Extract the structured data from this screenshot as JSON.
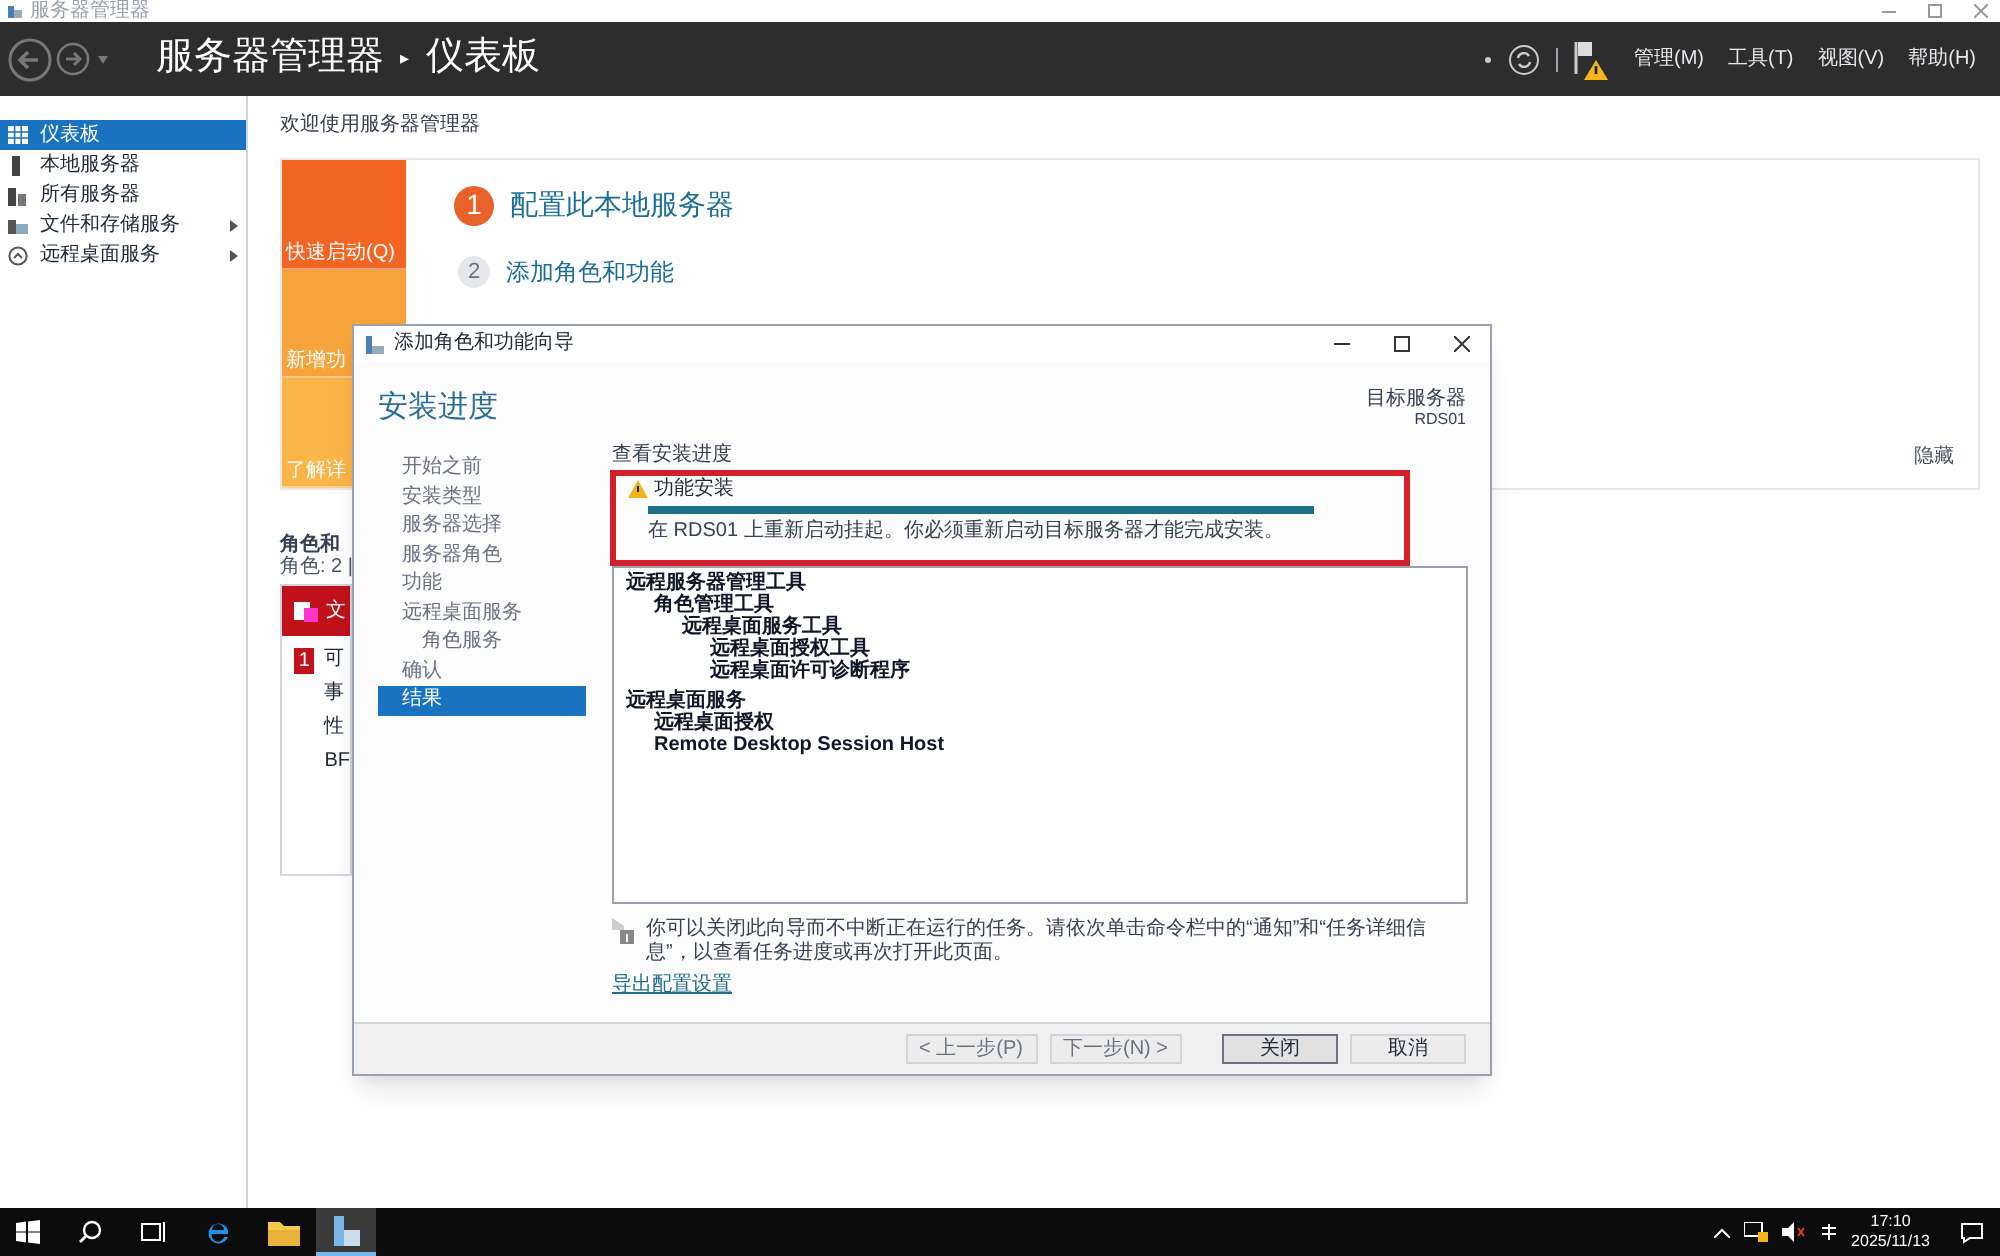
{
  "window": {
    "title": "服务器管理器"
  },
  "header": {
    "app": "服务器管理器",
    "separator": "▸",
    "page": "仪表板",
    "menus": [
      "管理(M)",
      "工具(T)",
      "视图(V)",
      "帮助(H)"
    ]
  },
  "sidebar": {
    "items": [
      {
        "label": "仪表板",
        "selected": true,
        "submenu": false
      },
      {
        "label": "本地服务器",
        "selected": false,
        "submenu": false
      },
      {
        "label": "所有服务器",
        "selected": false,
        "submenu": false
      },
      {
        "label": "文件和存储服务",
        "selected": false,
        "submenu": true
      },
      {
        "label": "远程桌面服务",
        "selected": false,
        "submenu": true
      }
    ]
  },
  "welcome": {
    "title": "欢迎使用服务器管理器",
    "tiles": [
      {
        "label": "快速启动(Q)",
        "color": "#f26522"
      },
      {
        "label": "新增功",
        "color": "#f7a33b"
      },
      {
        "label": "了解详",
        "color": "#fbb447"
      }
    ],
    "steps": [
      {
        "number": "1",
        "label": "配置此本地服务器",
        "active": true
      },
      {
        "number": "2",
        "label": "添加角色和功能",
        "active": false
      }
    ],
    "hide": "隐藏"
  },
  "roles": {
    "title": "角色和",
    "subtitle": "角色: 2 |",
    "card": {
      "title": "文",
      "badge": "1",
      "lines": [
        "可",
        "事",
        "性",
        "BF"
      ]
    }
  },
  "dialog": {
    "title": "添加角色和功能向导",
    "heading": "安装进度",
    "target_label": "目标服务器",
    "target": "RDS01",
    "nav": [
      {
        "label": "开始之前",
        "selected": false
      },
      {
        "label": "安装类型",
        "selected": false
      },
      {
        "label": "服务器选择",
        "selected": false
      },
      {
        "label": "服务器角色",
        "selected": false
      },
      {
        "label": "功能",
        "selected": false
      },
      {
        "label": "远程桌面服务",
        "selected": false,
        "children": [
          {
            "label": "角色服务",
            "selected": false
          }
        ]
      },
      {
        "label": "确认",
        "selected": false
      },
      {
        "label": "结果",
        "selected": true
      }
    ],
    "section": "查看安装进度",
    "status": {
      "title": "功能安装",
      "level": 1,
      "message": "在 RDS01 上重新启动挂起。你必须重新启动目标服务器才能完成安装。"
    },
    "tree": [
      {
        "label": "远程服务器管理工具",
        "children": [
          {
            "label": "角色管理工具",
            "children": [
              {
                "label": "远程桌面服务工具",
                "children": [
                  {
                    "label": "远程桌面授权工具"
                  },
                  {
                    "label": "远程桌面许可诊断程序"
                  }
                ]
              }
            ]
          }
        ]
      },
      {
        "label": "远程桌面服务",
        "children": [
          {
            "label": "远程桌面授权"
          },
          {
            "label": "Remote Desktop Session Host"
          }
        ]
      }
    ],
    "info": "你可以关闭此向导而不中断正在运行的任务。请依次单击命令栏中的“通知”和“任务详细信息”，以查看任务进度或再次打开此页面。",
    "export_link": "导出配置设置",
    "buttons": [
      {
        "label": "< 上一步(P)",
        "disabled": true,
        "default": false
      },
      {
        "label": "下一步(N) >",
        "disabled": true,
        "default": false
      },
      {
        "label": "关闭",
        "disabled": false,
        "default": true
      },
      {
        "label": "取消",
        "disabled": false,
        "default": false
      }
    ]
  },
  "taskbar": {
    "time": "17:10",
    "date": "2025/11/13"
  }
}
